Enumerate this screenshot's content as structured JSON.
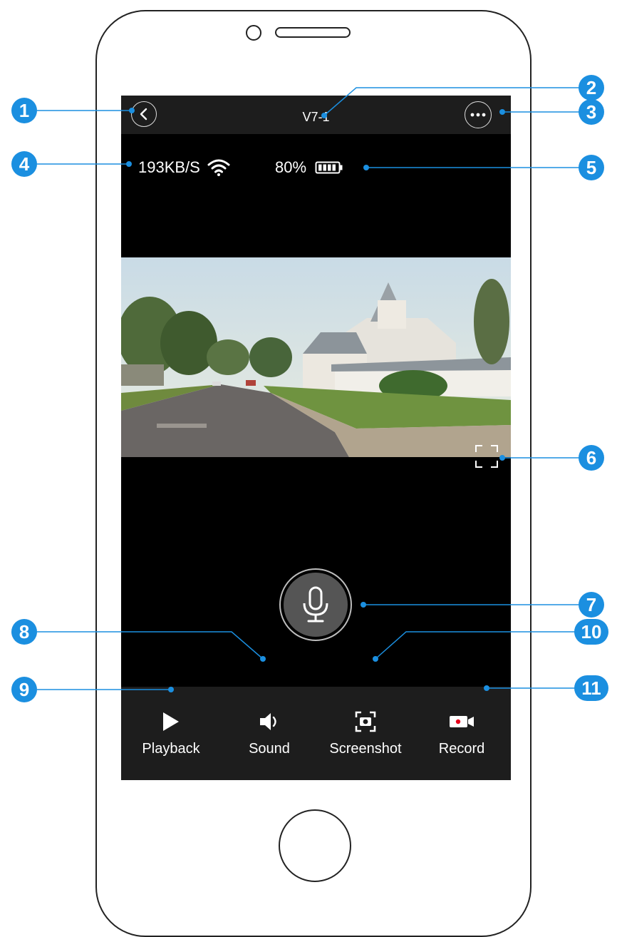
{
  "nav": {
    "title": "V7-1"
  },
  "status": {
    "bitrate": "193KB/S",
    "battery": "80%"
  },
  "toolbar": [
    {
      "id": "playback",
      "label": "Playback",
      "icon": "play-icon"
    },
    {
      "id": "sound",
      "label": "Sound",
      "icon": "speaker-icon"
    },
    {
      "id": "screenshot",
      "label": "Screenshot",
      "icon": "screenshot-icon"
    },
    {
      "id": "record",
      "label": "Record",
      "icon": "record-icon"
    }
  ],
  "callouts": [
    "1",
    "2",
    "3",
    "4",
    "5",
    "6",
    "7",
    "8",
    "9",
    "10",
    "11"
  ],
  "colors": {
    "callout": "#1b8fe0",
    "record_dot": "#e8001c",
    "bar": "#1d1d1d"
  }
}
